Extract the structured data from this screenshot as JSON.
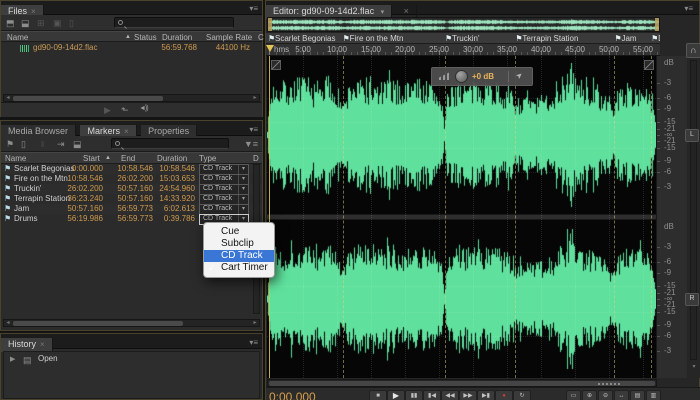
{
  "colors": {
    "waveform_green": "#5fe19d",
    "overview_green": "#9fe6c0",
    "value_orange": "#cf9a4e",
    "selection_blue": "#3a76d6",
    "record_red": "#c24040",
    "playhead_yellow": "#e2c554"
  },
  "files_panel": {
    "tab": "Files",
    "search_value": "",
    "toolbar_icons": [
      "open-file",
      "import-file",
      "new-file",
      "link",
      "delete"
    ],
    "columns": [
      "Name",
      "Status",
      "Duration",
      "Sample Rate",
      "C"
    ],
    "sort_arrow": "▲",
    "rows": [
      {
        "name": "gd90-09-14d2.flac",
        "status": "",
        "duration": "56:59.768",
        "sample_rate": "44100 Hz"
      }
    ],
    "bottom_icons": [
      "play",
      "open-in-editor",
      "auto-play"
    ]
  },
  "markers_panel": {
    "tabs": [
      "Media Browser",
      "Markers",
      "Properties"
    ],
    "active_tab": "Markers",
    "search_value": "",
    "toolbar_icons": [
      "add-marker",
      "delete-marker",
      "merge-markers",
      "insert-markers",
      "export-markers"
    ],
    "columns": [
      "Name",
      "Start",
      "End",
      "Duration",
      "Type",
      "D"
    ],
    "sort_arrow": "▲",
    "rows": [
      {
        "name": "Scarlet Begonias",
        "start": "0:00.000",
        "end": "10:58.546",
        "duration": "10:58.546",
        "type": "CD Track"
      },
      {
        "name": "Fire on the Mtn",
        "start": "10:58.546",
        "end": "26:02.200",
        "duration": "15:03.653",
        "type": "CD Track"
      },
      {
        "name": "Truckin'",
        "start": "26:02.200",
        "end": "50:57.160",
        "duration": "24:54.960",
        "type": "CD Track"
      },
      {
        "name": "Terrapin Station",
        "start": "36:23.240",
        "end": "50:57.160",
        "duration": "14:33.920",
        "type": "CD Track"
      },
      {
        "name": "Jam",
        "start": "50:57.160",
        "end": "56:59.773",
        "duration": "6:02.613",
        "type": "CD Track"
      },
      {
        "name": "Drums",
        "start": "56:19.986",
        "end": "56:59.773",
        "duration": "0:39.786",
        "type": "CD Track"
      }
    ]
  },
  "type_menu": {
    "items": [
      "Cue",
      "Subclip",
      "CD Track",
      "Cart Timer"
    ],
    "selected": "CD Track",
    "checkmark": "✓"
  },
  "history_panel": {
    "tab": "History",
    "items": [
      "Open"
    ]
  },
  "editor": {
    "tab": "Editor: gd90-09-14d2.flac",
    "time_format": "hms",
    "ruler_ticks": [
      "5:00",
      "10:00",
      "15:00",
      "20:00",
      "25:00",
      "30:00",
      "35:00",
      "40:00",
      "45:00",
      "50:00",
      "55:00"
    ],
    "total_minutes": 57,
    "markers": [
      {
        "name": "Scarlet Begonias",
        "pos_min": 0.0
      },
      {
        "name": "Fire on the Mtn",
        "pos_min": 10.976
      },
      {
        "name": "Truckin'",
        "pos_min": 26.037
      },
      {
        "name": "Terrapin Station",
        "pos_min": 36.387
      },
      {
        "name": "Jam",
        "pos_min": 50.953
      },
      {
        "name": "Drums",
        "pos_min": 56.333
      }
    ],
    "hud": {
      "gain_label": "+0 dB"
    },
    "db_unit": "dB",
    "db_labels": [
      "-3",
      "-6",
      "-9",
      "-15",
      "-21",
      "-∞",
      "-21",
      "-15",
      "-9",
      "-6",
      "-3"
    ],
    "channel_buttons": [
      "L",
      "R"
    ],
    "snap_icon": "∩",
    "current_time": "0:00.000",
    "transport": [
      {
        "name": "stop-button",
        "glyph": "■"
      },
      {
        "name": "play-button",
        "glyph": "▶"
      },
      {
        "name": "pause-button",
        "glyph": "▮▮"
      },
      {
        "name": "skip-back-button",
        "glyph": "▮◀"
      },
      {
        "name": "rewind-button",
        "glyph": "◀◀"
      },
      {
        "name": "fast-forward-button",
        "glyph": "▶▶"
      },
      {
        "name": "skip-forward-button",
        "glyph": "▶▮"
      },
      {
        "name": "record-button",
        "glyph": "●",
        "color": "#c24040"
      },
      {
        "name": "loop-button",
        "glyph": "↻"
      }
    ],
    "zoom_buttons": [
      "zoom-in-time",
      "zoom-out-time",
      "zoom-in-amplitude",
      "zoom-out-amplitude",
      "zoom-selection",
      "zoom-full"
    ]
  }
}
